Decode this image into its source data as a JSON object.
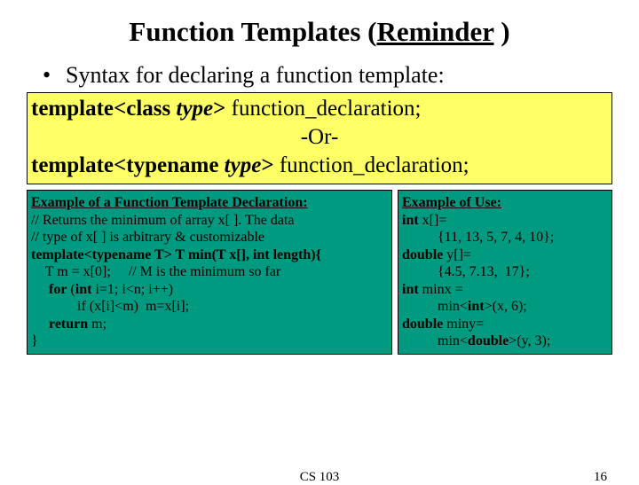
{
  "title_prefix": "Function Templates (",
  "title_under": "Reminder",
  "title_suffix": " )",
  "bullet": "Syntax for declaring a function template:",
  "yellow": {
    "l1_a": "template<class ",
    "l1_b": "type",
    "l1_c": "> ",
    "l1_d": "function_declaration;",
    "or": "-Or-",
    "l3_a": "template<typename ",
    "l3_b": "type",
    "l3_c": "> ",
    "l3_d": "function_declaration;"
  },
  "left": {
    "hdr": "Example of a Function Template Declaration:",
    "c1": "// Returns the minimum of array x[ ]. The data",
    "c2": "// type of x[ ] is arbitrary & customizable",
    "c3a": "template<typename T> T min(T x[], int length){",
    "c4": "    T m = x[0];     // M is the minimum so far",
    "c5a": "     ",
    "c5b": "for",
    "c5c": " (",
    "c5d": "int",
    "c5e": " i=1; i<n; i++)",
    "c6": "             if (x[i]<m)  m=x[i];",
    "c7a": "     ",
    "c7b": "return",
    "c7c": " m;",
    "c8": "}"
  },
  "right": {
    "hdr": "Example of Use:",
    "r1a": "int",
    "r1b": " x[]=",
    "r2": "          {11, 13, 5, 7, 4, 10};",
    "r3a": "double",
    "r3b": " y[]=",
    "r4": "          {4.5, 7.13,  17};",
    "r5a": "int",
    "r5b": " minx =",
    "r6a": "          min<",
    "r6b": "int",
    "r6c": ">(x, 6);",
    "r7a": "double",
    "r7b": " miny=",
    "r8a": "          min<",
    "r8b": "double",
    "r8c": ">(y, 3);"
  },
  "footer_center": "CS 103",
  "footer_page": "16"
}
